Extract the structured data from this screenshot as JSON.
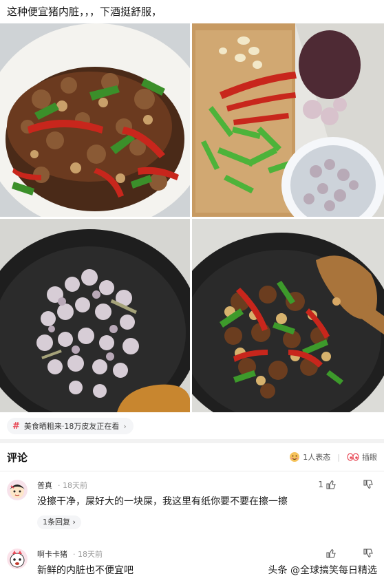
{
  "post": {
    "text": "这种便宜猪内脏，，，下酒挺舒服，"
  },
  "photos": [
    {
      "name": "stir-fried-dish-photo"
    },
    {
      "name": "raw-ingredients-photo"
    },
    {
      "name": "cooking-offal-in-wok-photo"
    },
    {
      "name": "finished-stir-fry-in-wok-photo"
    }
  ],
  "topic": {
    "icon": "hash-icon",
    "label": "美食晒粗来·18万皮友正在看",
    "chevron": "›"
  },
  "comments_header": {
    "title": "评论",
    "reactions_label": "1人表态",
    "insert_label": "插眼"
  },
  "comments": [
    {
      "user": "普真",
      "time": "· 18天前",
      "text": "没擦干净，屎好大的一块屎，我这里有纸你要不要在擦一擦",
      "likes": "1",
      "replies": "1条回复 ›"
    },
    {
      "user": "啊卡卡猪",
      "time": "· 18天前",
      "text": "新鲜的内脏也不便宜吧",
      "likes": ""
    }
  ],
  "watermark": "头条 @全球搞笑每日精选"
}
